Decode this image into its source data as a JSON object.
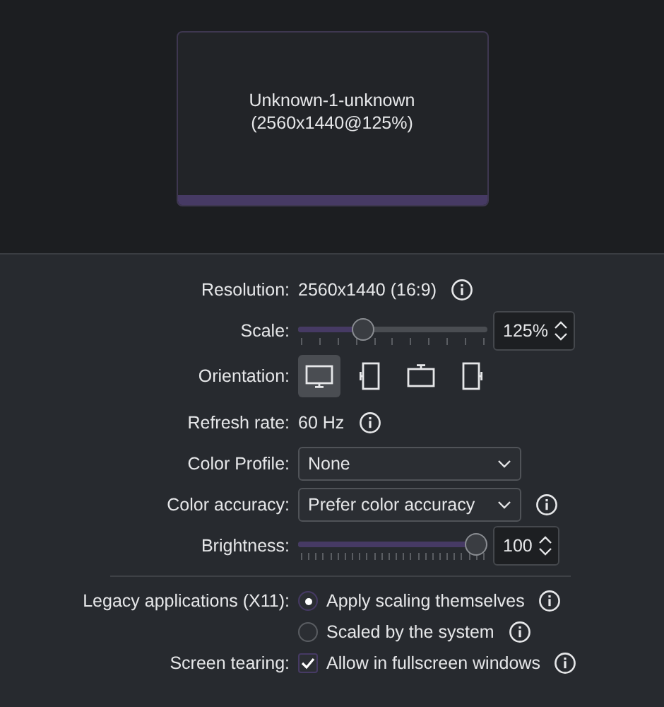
{
  "monitor": {
    "name": "Unknown-1-unknown",
    "mode": "(2560x1440@125%)"
  },
  "groups": [
    {
      "rows": [
        {
          "kind": "text",
          "label": "Resolution:",
          "value": "2560x1440 (16:9)",
          "info": true
        },
        {
          "kind": "slider",
          "label": "Scale:",
          "level": 0.32,
          "reading": "125%"
        },
        {
          "kind": "orientation",
          "label": "Orientation:",
          "options": [
            {
              "kind": "landscape",
              "selected": true
            },
            {
              "kind": "left",
              "selected": false
            },
            {
              "kind": "flipped",
              "selected": false
            },
            {
              "kind": "right",
              "selected": false
            }
          ]
        },
        {
          "kind": "text",
          "label": "Refresh rate:",
          "value": "60 Hz",
          "info": true
        },
        {
          "kind": "combo",
          "label": "Color Profile:",
          "value": "None"
        },
        {
          "kind": "combo",
          "label": "Color accuracy:",
          "value": "Prefer color accuracy",
          "info": true
        },
        {
          "kind": "slider",
          "label": "Brightness:",
          "level": 1.0,
          "reading": "100"
        }
      ]
    },
    {
      "rows": [
        {
          "kind": "radio",
          "label": "Legacy applications (X11):",
          "options": [
            {
              "text": "Apply scaling themselves",
              "selected": true,
              "info": true
            },
            {
              "text": "Scaled by the system",
              "selected": false,
              "info": true
            }
          ]
        },
        {
          "kind": "checkbox",
          "label": "Screen tearing:",
          "text": "Allow in fullscreen windows",
          "checked": true,
          "info": true
        }
      ]
    }
  ]
}
